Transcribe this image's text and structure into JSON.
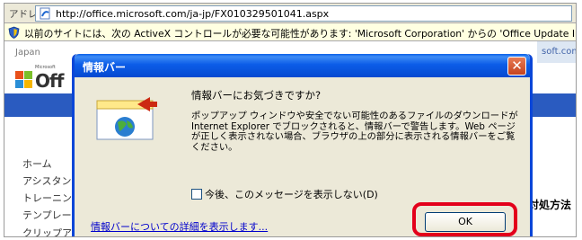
{
  "address_bar": {
    "label": "アドレス(D)",
    "url": "http://office.microsoft.com/ja-jp/FX010329501041.aspx"
  },
  "info_bar": {
    "text": "以前のサイトには、次の ActiveX コントロールが必要な可能性があります: 'Microsoft Corporation' からの 'Office Update In"
  },
  "background_page": {
    "region": "Japan",
    "site_right": "soft.com",
    "logo_text": "Off",
    "logo_small": "Microsoft",
    "nav": [
      "ホーム",
      "アシスタント",
      "トレーニング",
      "テンプレート",
      "クリップアート"
    ],
    "right_heading": "対処方法"
  },
  "dialog": {
    "title": "情報バー",
    "close_label": "✕",
    "heading": "情報バーにお気づきですか?",
    "body": "ポップアップ ウィンドウや安全でない可能性のあるファイルのダウンロードが Internet Explorer でブロックされると、情報バーで警告します。Web ページが正しく表示されない場合、ブラウザの上の部分に表示される情報バーをご覧ください。",
    "checkbox_label": "今後、このメッセージを表示しない(D)",
    "checkbox_checked": false,
    "details_link": "情報バーについての詳細を表示します...",
    "ok_label": "OK"
  },
  "colors": {
    "title_bar": "#0549d0",
    "highlight": "#e3001b",
    "info_bar_bg": "#ffffe1"
  }
}
